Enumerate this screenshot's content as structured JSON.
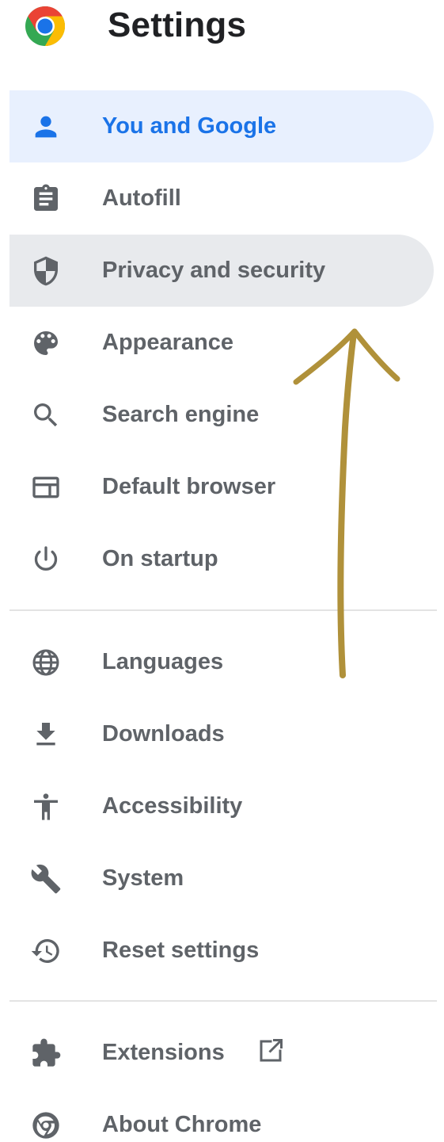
{
  "header": {
    "title": "Settings",
    "logo_icon": "chrome-logo-icon"
  },
  "colors": {
    "active_bg": "#e8f0fe",
    "active_text": "#1a73e8",
    "hover_bg": "#e8eaed",
    "text": "#5f6368",
    "title": "#202124",
    "annotation_arrow": "#b0913a"
  },
  "nav": {
    "items": [
      {
        "label": "You and Google",
        "icon": "person-icon",
        "state": "active"
      },
      {
        "label": "Autofill",
        "icon": "clipboard-icon",
        "state": ""
      },
      {
        "label": "Privacy and security",
        "icon": "shield-icon",
        "state": "hover"
      },
      {
        "label": "Appearance",
        "icon": "palette-icon",
        "state": ""
      },
      {
        "label": "Search engine",
        "icon": "search-icon",
        "state": ""
      },
      {
        "label": "Default browser",
        "icon": "browser-window-icon",
        "state": ""
      },
      {
        "label": "On startup",
        "icon": "power-icon",
        "state": ""
      },
      {
        "label": "Languages",
        "icon": "globe-icon",
        "state": ""
      },
      {
        "label": "Downloads",
        "icon": "download-icon",
        "state": ""
      },
      {
        "label": "Accessibility",
        "icon": "accessibility-icon",
        "state": ""
      },
      {
        "label": "System",
        "icon": "wrench-icon",
        "state": ""
      },
      {
        "label": "Reset settings",
        "icon": "history-icon",
        "state": ""
      },
      {
        "label": "Extensions",
        "icon": "puzzle-icon",
        "state": "",
        "trailing_icon": "open-in-new-icon"
      },
      {
        "label": "About Chrome",
        "icon": "chrome-outline-icon",
        "state": ""
      }
    ]
  }
}
